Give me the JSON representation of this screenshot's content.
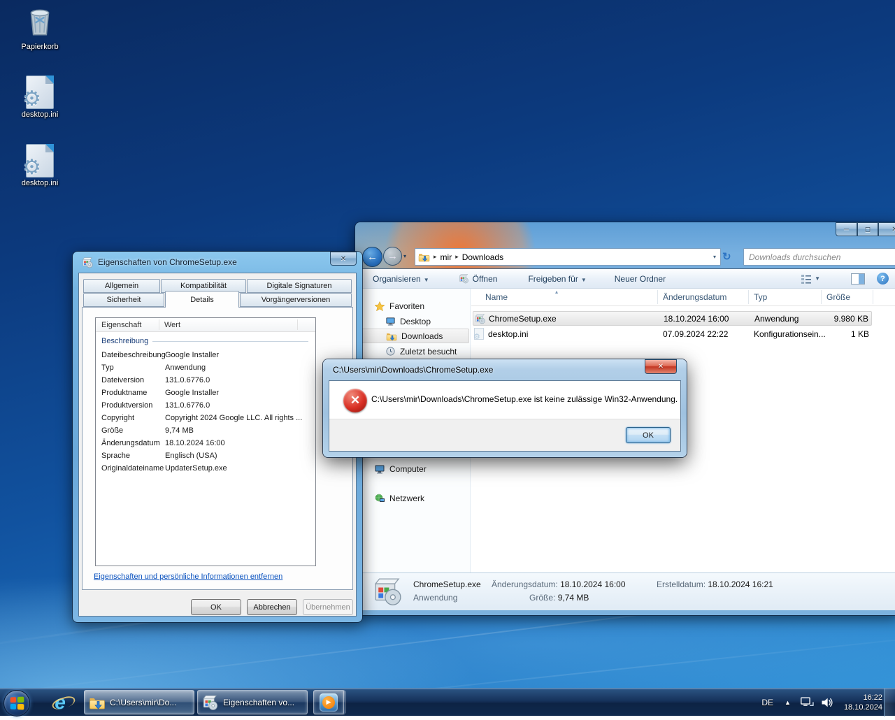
{
  "desktop": {
    "icons": [
      {
        "label": "Papierkorb"
      },
      {
        "label": "desktop.ini"
      },
      {
        "label": "desktop.ini"
      }
    ]
  },
  "explorer": {
    "breadcrumb": {
      "segments": [
        "mir",
        "Downloads"
      ]
    },
    "search_placeholder": "Downloads durchsuchen",
    "toolbar": {
      "organize": "Organisieren",
      "open": "Öffnen",
      "share": "Freigeben für",
      "new_folder": "Neuer Ordner"
    },
    "sidebar": {
      "favorites": "Favoriten",
      "desktop": "Desktop",
      "downloads": "Downloads",
      "recent": "Zuletzt besucht",
      "computer": "Computer",
      "network": "Netzwerk"
    },
    "columns": {
      "name": "Name",
      "date": "Änderungsdatum",
      "type": "Typ",
      "size": "Größe"
    },
    "files": [
      {
        "name": "ChromeSetup.exe",
        "date": "18.10.2024 16:00",
        "type": "Anwendung",
        "size": "9.980 KB"
      },
      {
        "name": "desktop.ini",
        "date": "07.09.2024 22:22",
        "type": "Konfigurationsein...",
        "size": "1 KB"
      }
    ],
    "details_pane": {
      "file_name": "ChromeSetup.exe",
      "file_type": "Anwendung",
      "modified_label": "Änderungsdatum:",
      "modified_value": "18.10.2024 16:00",
      "size_label": "Größe:",
      "size_value": "9,74 MB",
      "created_label": "Erstelldatum:",
      "created_value": "18.10.2024 16:21"
    }
  },
  "properties_dialog": {
    "title": "Eigenschaften von ChromeSetup.exe",
    "tabs_row1": [
      {
        "label": "Allgemein"
      },
      {
        "label": "Kompatibilität"
      },
      {
        "label": "Digitale Signaturen"
      }
    ],
    "tabs_row2": [
      {
        "label": "Sicherheit"
      },
      {
        "label": "Details"
      },
      {
        "label": "Vorgängerversionen"
      }
    ],
    "list_headers": {
      "property": "Eigenschaft",
      "value": "Wert"
    },
    "group": "Beschreibung",
    "rows": [
      {
        "label": "Dateibeschreibung",
        "value": "Google Installer"
      },
      {
        "label": "Typ",
        "value": "Anwendung"
      },
      {
        "label": "Dateiversion",
        "value": "131.0.6776.0"
      },
      {
        "label": "Produktname",
        "value": "Google Installer"
      },
      {
        "label": "Produktversion",
        "value": "131.0.6776.0"
      },
      {
        "label": "Copyright",
        "value": "Copyright 2024 Google LLC. All rights ..."
      },
      {
        "label": "Größe",
        "value": "9,74 MB"
      },
      {
        "label": "Änderungsdatum",
        "value": "18.10.2024 16:00"
      },
      {
        "label": "Sprache",
        "value": "Englisch (USA)"
      },
      {
        "label": "Originaldateiname",
        "value": "UpdaterSetup.exe"
      }
    ],
    "remove_link": "Eigenschaften und persönliche Informationen entfernen",
    "buttons": {
      "ok": "OK",
      "cancel": "Abbrechen",
      "apply": "Übernehmen"
    }
  },
  "error_dialog": {
    "title": "C:\\Users\\mir\\Downloads\\ChromeSetup.exe",
    "message": "C:\\Users\\mir\\Downloads\\ChromeSetup.exe ist keine zulässige Win32-Anwendung.",
    "ok": "OK"
  },
  "taskbar": {
    "window_buttons": [
      {
        "label": "C:\\Users\\mir\\Do..."
      },
      {
        "label": "Eigenschaften vo..."
      }
    ],
    "tray": {
      "language": "DE",
      "time": "16:22",
      "date": "18.10.2024"
    }
  },
  "colors": {
    "accent_blue": "#1c6fbe",
    "error_red": "#d93025",
    "selection_gray": "#e8e8e8"
  }
}
